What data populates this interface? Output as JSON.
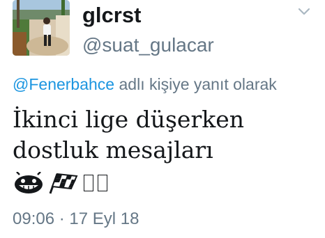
{
  "user": {
    "display_name": "glcrst",
    "handle": "@suat_gulacar"
  },
  "reply": {
    "mention": "@Fenerbahce",
    "suffix": "adlı kişiye yanıt olarak"
  },
  "tweet": {
    "line1": "İkinci lige düşerken",
    "line2": "dostluk mesajları",
    "emojis": [
      "grinning-face-icon",
      "checkered-flag-icon",
      "unknown-glyph",
      "unknown-glyph"
    ]
  },
  "meta": {
    "time": "09:06",
    "separator": "·",
    "date": "17 Eyl 18"
  },
  "colors": {
    "link": "#1b95e0",
    "secondary_text": "#657786",
    "primary_text": "#14171a"
  }
}
